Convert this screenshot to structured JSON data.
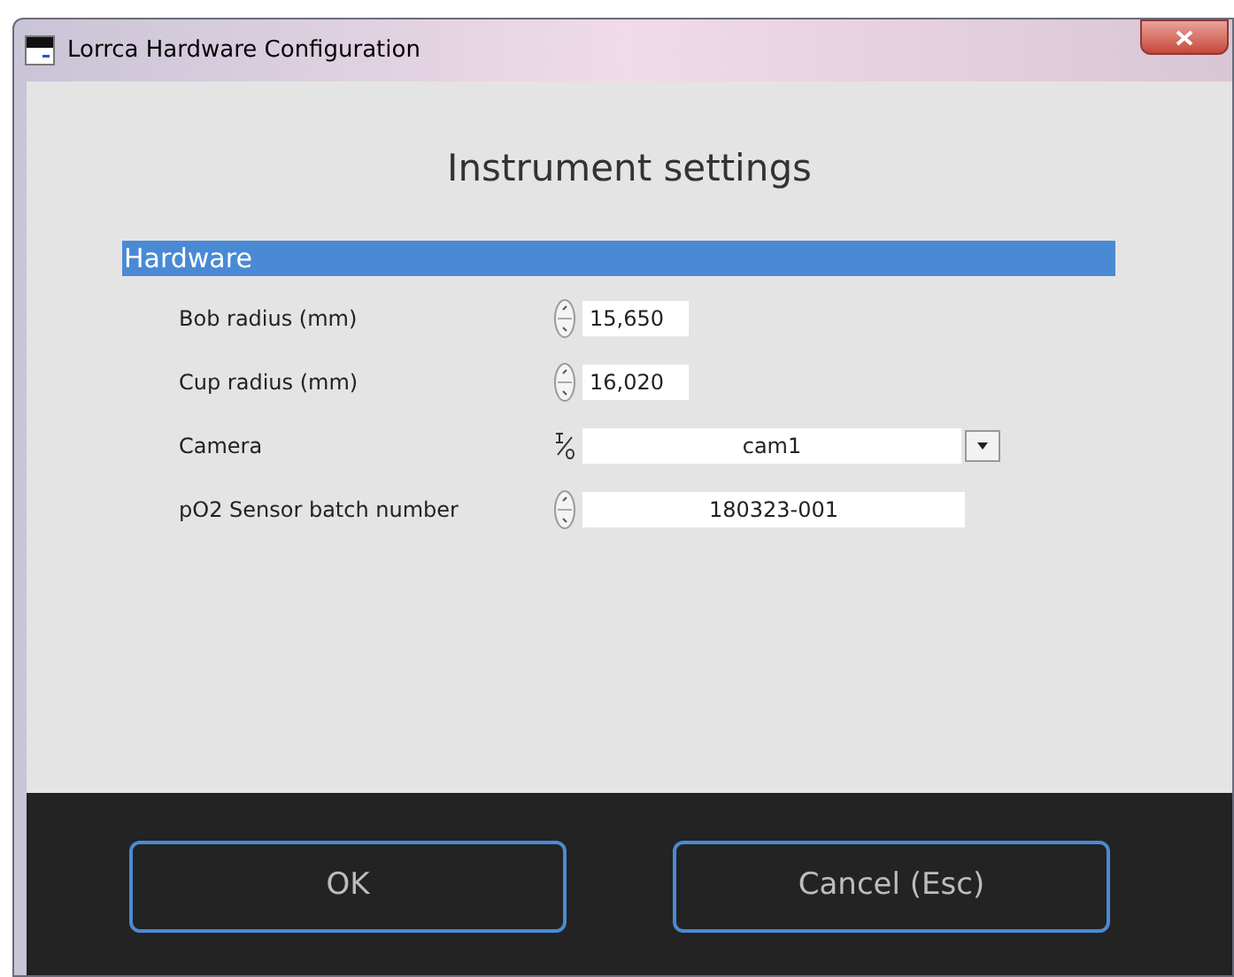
{
  "window": {
    "title": "Lorrca Hardware Configuration"
  },
  "heading": "Instrument settings",
  "section": "Hardware",
  "fields": [
    {
      "kind": "numeric",
      "label": "Bob radius (mm)",
      "value": "15,650"
    },
    {
      "kind": "numeric",
      "label": "Cup radius (mm)",
      "value": "16,020"
    },
    {
      "kind": "enum",
      "label": "Camera",
      "value": "cam1"
    },
    {
      "kind": "string",
      "label": "pO2 Sensor batch number",
      "value": "180323-001"
    }
  ],
  "buttons": [
    "OK",
    "Cancel (Esc)"
  ]
}
